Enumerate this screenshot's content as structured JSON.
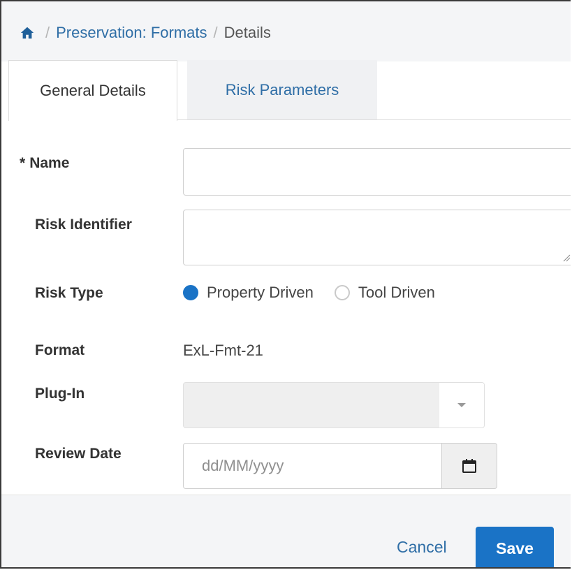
{
  "breadcrumb": {
    "home_icon": "home-icon",
    "separator": "/",
    "items": [
      "Preservation: Formats",
      "Details"
    ]
  },
  "tabs": [
    {
      "label": "General Details",
      "active": true
    },
    {
      "label": "Risk Parameters",
      "active": false
    }
  ],
  "form": {
    "name": {
      "label": "Name",
      "required_marker": "*",
      "value": ""
    },
    "risk_identifier": {
      "label": "Risk Identifier",
      "value": ""
    },
    "risk_type": {
      "label": "Risk Type",
      "options": [
        {
          "label": "Property Driven",
          "selected": true
        },
        {
          "label": "Tool Driven",
          "selected": false
        }
      ]
    },
    "format": {
      "label": "Format",
      "value": "ExL-Fmt-21"
    },
    "plug_in": {
      "label": "Plug-In",
      "value": ""
    },
    "review_date": {
      "label": "Review Date",
      "placeholder": "dd/MM/yyyy",
      "value": "",
      "icon": "calendar-icon"
    }
  },
  "footer": {
    "cancel_label": "Cancel",
    "save_label": "Save"
  },
  "colors": {
    "accent": "#1a73c6",
    "link": "#2f6ea6",
    "background_bar": "#f4f5f7"
  }
}
